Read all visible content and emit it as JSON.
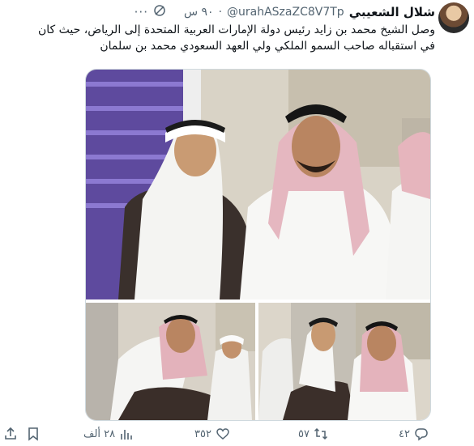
{
  "tweet": {
    "author_name": "شلال الشعيبي",
    "handle": "@urahASzaZC8V7Tp",
    "time": "٩٠ س",
    "text_line1": "وصل الشيخ محمد بن زايد رئيس دولة الإمارات العربية المتحدة إلى الرياض، حيث كان",
    "text_line2": "في استقباله صاحب السمو الملكي ولي العهد السعودي محمد بن سلمان"
  },
  "icons": {
    "more": "more-icon",
    "grok": "grok-icon",
    "reply": "reply-icon",
    "retweet": "retweet-icon",
    "like": "heart-icon",
    "views": "views-icon",
    "bookmark": "bookmark-icon",
    "share": "share-icon"
  },
  "actions": {
    "replies": "٤٢",
    "retweets": "٥٧",
    "likes": "٣٥٢",
    "views": "٢٨ ألف"
  },
  "colors": {
    "text": "#0f1419",
    "secondary": "#536471",
    "border": "#cfd9de"
  }
}
